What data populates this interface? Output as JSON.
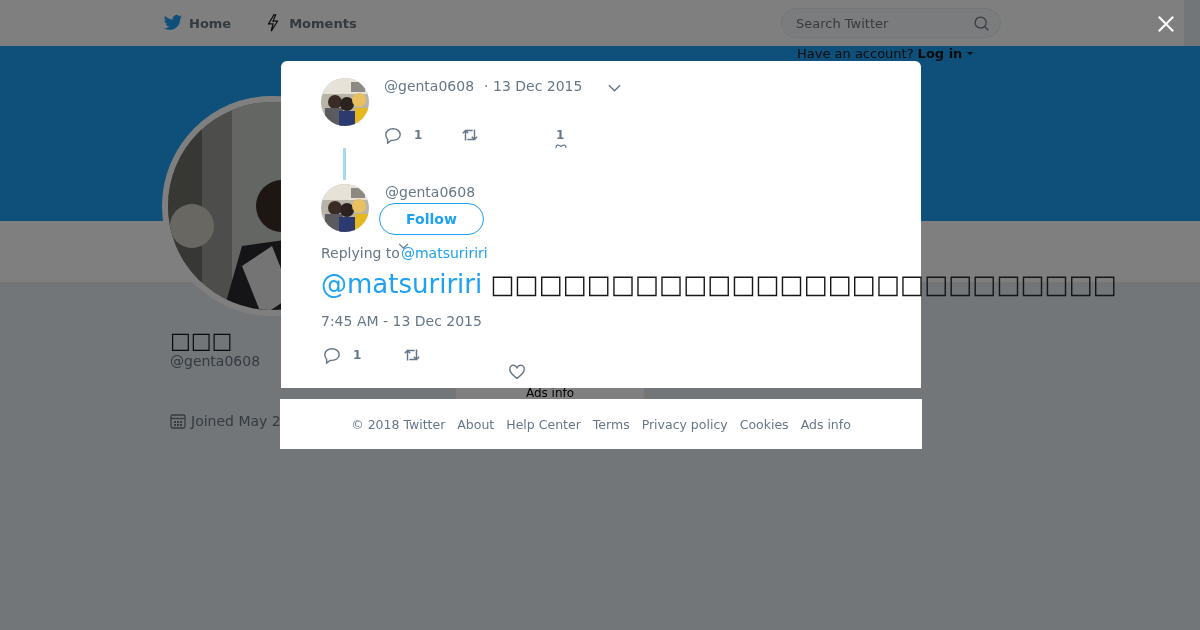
{
  "nav": {
    "items": [
      {
        "label": "Home",
        "kind": "bird"
      },
      {
        "label": "Moments",
        "kind": "bolt"
      }
    ],
    "search": {
      "placeholder": "Search Twitter"
    },
    "login": {
      "prompt": "Have an account?",
      "link": "Log in"
    }
  },
  "profile": {
    "name": "□□□",
    "handle": "@genta0608",
    "joined": "Joined May 2"
  },
  "ads_card": {
    "label": "Ads info"
  },
  "modal": {
    "parent_tweet": {
      "handle": "@genta0608",
      "date": "· 13 Dec 2015",
      "replies": "1",
      "likes": "1"
    },
    "tweet": {
      "handle": "@genta0608",
      "follow": "Follow",
      "replying_label": "Replying to",
      "replying_to": "@matsuririri",
      "mention": "@matsuririri",
      "text": "□□□□□□□□□□□□□□□□□□□□□□□□□□",
      "time": "7:45 AM - 13 Dec 2015",
      "replies": "1"
    }
  },
  "footer": {
    "links": [
      "© 2018 Twitter",
      "About",
      "Help Center",
      "Terms",
      "Privacy policy",
      "Cookies",
      "Ads info"
    ]
  }
}
